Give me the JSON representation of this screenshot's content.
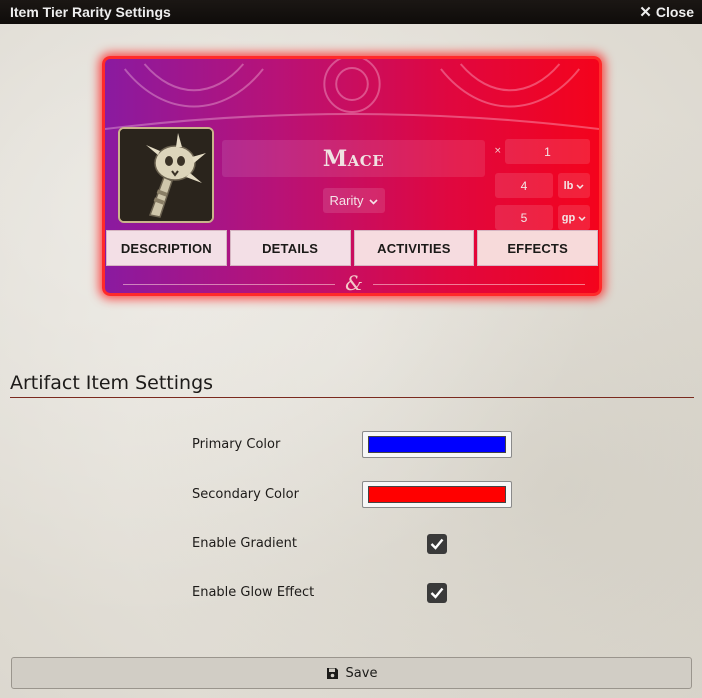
{
  "window": {
    "title": "Item Tier Rarity Settings",
    "close_label": "Close"
  },
  "preview": {
    "item_name": "Mace",
    "rarity_label": "Rarity",
    "quantity": "1",
    "quantity_symbol": "×",
    "weight": "4",
    "weight_unit": "lb",
    "price": "5",
    "price_unit": "gp",
    "tabs": [
      "DESCRIPTION",
      "DETAILS",
      "ACTIVITIES",
      "EFFECTS"
    ],
    "divider_glyph": "&",
    "portrait_icon": "mace-item-image"
  },
  "settings": {
    "section_title": "Artifact Item Settings",
    "primary_color_label": "Primary Color",
    "primary_color": "#0000ff",
    "secondary_color_label": "Secondary Color",
    "secondary_color": "#ff0000",
    "gradient_label": "Enable Gradient",
    "gradient_enabled": true,
    "glow_label": "Enable Glow Effect",
    "glow_enabled": true
  },
  "footer": {
    "save_label": "Save",
    "save_icon": "floppy-disk-icon"
  }
}
